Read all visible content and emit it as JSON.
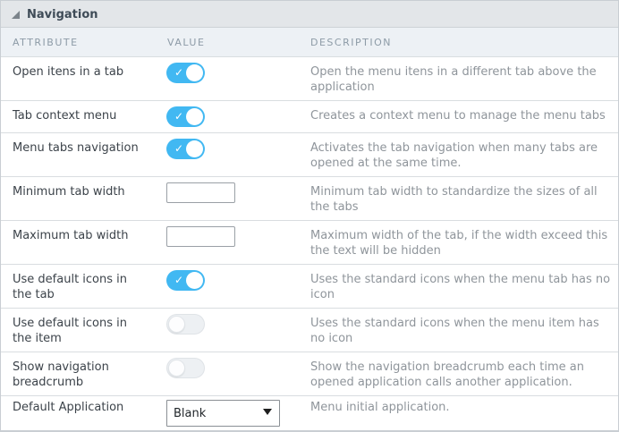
{
  "panel": {
    "title": "Navigation",
    "collapse_icon": "triangle-collapse"
  },
  "table": {
    "headers": [
      "ATTRIBUTE",
      "VALUE",
      "DESCRIPTION"
    ],
    "rows": [
      {
        "id": "open-itens-in-a-tab",
        "attribute": "Open itens in a tab",
        "control": {
          "type": "toggle",
          "state": "on"
        },
        "description": "Open the menu itens in a different tab above the application"
      },
      {
        "id": "tab-context-menu",
        "attribute": "Tab context menu",
        "control": {
          "type": "toggle",
          "state": "on"
        },
        "description": "Creates a context menu to manage the menu tabs"
      },
      {
        "id": "menu-tabs-navigation",
        "attribute": "Menu tabs navigation",
        "control": {
          "type": "toggle",
          "state": "on"
        },
        "description": "Activates the tab navigation when many tabs are opened at the same time."
      },
      {
        "id": "minimum-tab-width",
        "attribute": "Minimum tab width",
        "control": {
          "type": "input",
          "value": "",
          "placeholder": ""
        },
        "description": "Minimum tab width to standardize the sizes of all the tabs"
      },
      {
        "id": "maximum-tab-width",
        "attribute": "Maximum tab width",
        "control": {
          "type": "input",
          "value": "",
          "placeholder": ""
        },
        "description": "Maximum width of the tab, if the width exceed this the text will be hidden"
      },
      {
        "id": "use-default-icons-in-the-tab",
        "attribute": "Use default icons in the tab",
        "control": {
          "type": "toggle",
          "state": "on"
        },
        "description": "Uses the standard icons when the menu tab has no icon"
      },
      {
        "id": "use-default-icons-in-the-item",
        "attribute": "Use default icons in the item",
        "control": {
          "type": "toggle",
          "state": "off"
        },
        "description": "Uses the standard icons when the menu item has no icon"
      },
      {
        "id": "show-navigation-breadcrumb",
        "attribute": "Show navigation breadcrumb",
        "control": {
          "type": "toggle",
          "state": "off"
        },
        "description": "Show the navigation breadcrumb each time an opened application calls another application."
      },
      {
        "id": "default-application",
        "attribute": "Default Application",
        "control": {
          "type": "select",
          "value": "Blank"
        },
        "description": "Menu initial application."
      }
    ]
  },
  "icons": {
    "toggle_check": "✓"
  },
  "colors": {
    "toggle_on": "#41b8f2",
    "toggle_off_track": "#edf0f3",
    "header_bg": "#e3e6e9",
    "colhead_bg": "#edf1f5",
    "colhead_text": "#8d9ba7",
    "attribute_text": "#3c434a",
    "description_text": "#8f959b",
    "row_border": "#d9dde0",
    "panel_border": "#c9ced3"
  }
}
